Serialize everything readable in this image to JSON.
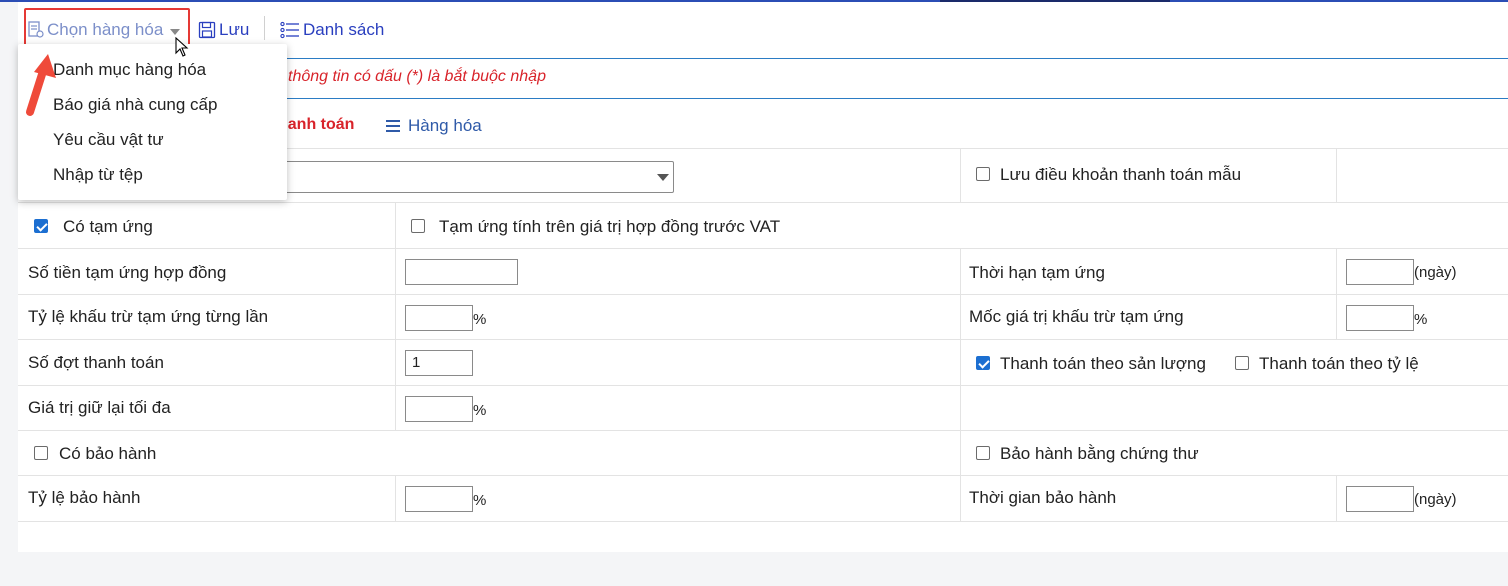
{
  "toolbar": {
    "chon_label": "Chọn hàng hóa",
    "luu_label": "Lưu",
    "ds_label": "Danh sách"
  },
  "dropdown": {
    "items": [
      "Danh mục hàng hóa",
      "Báo giá nhà cung cấp",
      "Yêu cầu vật tư",
      "Nhập từ tệp"
    ]
  },
  "notice": "thông tin có dấu (*) là bắt buộc nhập",
  "tabs": {
    "active_partial": "hanh toán",
    "goods": "Hàng hóa"
  },
  "form": {
    "luu_dieu_khoan": "Lưu điều khoản thanh toán mẫu",
    "co_tam_ung": "Có tạm ứng",
    "tam_ung_truoc_vat": "Tạm ứng tính trên giá trị hợp đồng trước VAT",
    "so_tien_tam_ung": "Số tiền tạm ứng hợp đồng",
    "thoi_han_tam_ung": "Thời hạn tạm ứng",
    "ty_le_khau_tru": "Tỷ lệ khấu trừ tạm ứng từng lần",
    "moc_gia_tri": "Mốc giá trị khấu trừ tạm ứng",
    "so_dot": "Số đợt thanh toán",
    "so_dot_value": "1",
    "tt_san_luong": "Thanh toán theo sản lượng",
    "tt_ty_le": "Thanh toán theo tỷ lệ",
    "gia_tri_giu_lai": "Giá trị giữ lại tối đa",
    "co_bao_hanh": "Có bảo hành",
    "bao_hanh_chung_thu": "Bảo hành bằng chứng thư",
    "ty_le_bao_hanh": "Tỷ lệ bảo hành",
    "thoi_gian_bao_hanh": "Thời gian bảo hành",
    "unit_ngay": "(ngày)",
    "unit_pct": "%"
  },
  "checkbox_states": {
    "luu_dieu_khoan": false,
    "co_tam_ung": true,
    "tam_ung_truoc_vat": false,
    "tt_san_luong": true,
    "tt_ty_le": false,
    "co_bao_hanh": false,
    "bao_hanh_chung_thu": false
  },
  "colors": {
    "accent": "#2a3fbf",
    "required_red": "#d8232a",
    "checkbox_blue": "#1c6fd1",
    "highlight_red": "#e53935"
  }
}
